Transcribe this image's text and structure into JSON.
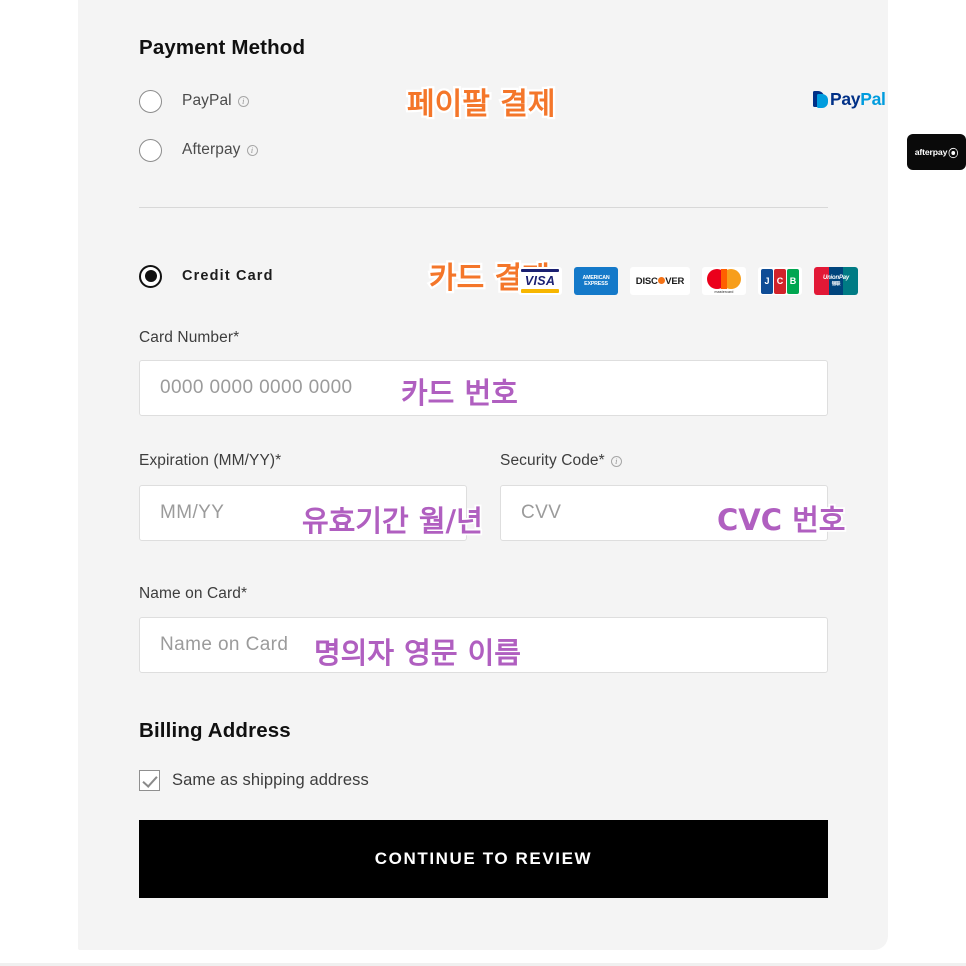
{
  "panel": {
    "background": "#f4f4f4"
  },
  "payment_method": {
    "title": "Payment Method",
    "options": [
      {
        "label": "PayPal",
        "info_icon": "info-icon",
        "selected": false,
        "annotation": "페이팔 결제",
        "annotation_color": "#f4762a",
        "logo": {
          "name": "paypal-logo",
          "text_primary": "Pay",
          "text_secondary": "Pal",
          "color_primary": "#003087",
          "color_secondary": "#009cde"
        }
      },
      {
        "label": "Afterpay",
        "info_icon": "info-icon",
        "selected": false,
        "logo": {
          "name": "afterpay-logo",
          "text": "afterpay",
          "mark": "❧",
          "background": "#0a0a0a",
          "color": "#ffffff"
        }
      },
      {
        "label": "Credit Card",
        "selected": true,
        "annotation": "카드 결제",
        "annotation_color": "#f4762a"
      }
    ]
  },
  "card_brands": [
    {
      "name": "visa",
      "label": "VISA",
      "colors": [
        "#1a1f71",
        "#f7b600"
      ]
    },
    {
      "name": "amex",
      "label": "AMERICAN EXPRESS",
      "colors": [
        "#1479c9"
      ]
    },
    {
      "name": "discover",
      "label": "DISC VER",
      "colors": [
        "#f47216"
      ]
    },
    {
      "name": "mastercard",
      "label": "mastercard",
      "colors": [
        "#eb001b",
        "#f79e1b",
        "#ff5f00"
      ]
    },
    {
      "name": "jcb",
      "label": "JCB",
      "colors": [
        "#0e4c96",
        "#d2232a",
        "#00a650"
      ]
    },
    {
      "name": "unionpay",
      "label": "UnionPay",
      "colors": [
        "#e21836",
        "#00447c",
        "#007b84"
      ]
    }
  ],
  "fields": {
    "card_number": {
      "label": "Card Number*",
      "placeholder": "0000 0000 0000 0000",
      "value": "",
      "annotation": "카드 번호",
      "annotation_color": "#b05fc0"
    },
    "expiration": {
      "label": "Expiration (MM/YY)*",
      "placeholder": "MM/YY",
      "value": "",
      "annotation": "유효기간 월/년",
      "annotation_color": "#b05fc0"
    },
    "security_code": {
      "label": "Security Code*",
      "info_icon": "info-icon",
      "placeholder": "CVV",
      "value": "",
      "annotation": "CVC 번호",
      "annotation_color": "#b05fc0"
    },
    "name_on_card": {
      "label": "Name on Card*",
      "placeholder": "Name on Card",
      "value": "",
      "annotation": "명의자 영문 이름",
      "annotation_color": "#b05fc0"
    }
  },
  "billing_address": {
    "title": "Billing Address",
    "same_as_shipping_label": "Same as shipping address",
    "same_as_shipping_checked": true
  },
  "submit": {
    "label": "CONTINUE TO REVIEW",
    "background": "#000000",
    "color": "#ffffff"
  },
  "amex_lines": {
    "l1": "AMERICAN",
    "l2": "EXPRESS"
  },
  "discover": {
    "pre": "DISC",
    "post": "VER"
  },
  "jcb": {
    "j": "J",
    "c": "C",
    "b": "B"
  },
  "unionpay": {
    "main": "UnionPay",
    "sub": "银联"
  }
}
